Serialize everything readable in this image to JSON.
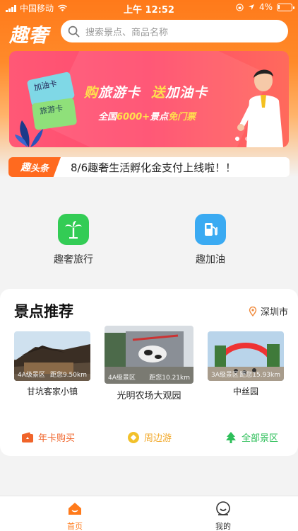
{
  "status_bar": {
    "carrier": "中国移动",
    "time": "上午 12:52",
    "battery": "4%"
  },
  "header": {
    "logo": "趣奢",
    "search_placeholder": "搜索景点、商品名称"
  },
  "banner": {
    "card_top": "加油卡",
    "card_bottom": "旅游卡",
    "title_a_hl": "购",
    "title_a": "旅游卡",
    "title_b_hl": "送",
    "title_b": "加油卡",
    "sub_a": "全国",
    "sub_num": "6000+",
    "sub_b": "景点",
    "sub_hl": "免门票"
  },
  "headline": {
    "badge_a": "趣",
    "badge_b": "头条",
    "text": "8/6趣奢生活孵化金支付上线啦！！"
  },
  "services": [
    {
      "label": "趣奢旅行",
      "icon": "palm-tree-icon",
      "color": "#33cc55"
    },
    {
      "label": "趣加油",
      "icon": "fuel-pump-icon",
      "color": "#3aaaf2"
    }
  ],
  "recommend": {
    "title": "景点推荐",
    "location": "深圳市",
    "spots": [
      {
        "name": "甘坑客家小镇",
        "tag": "4A级景区",
        "distance": "距您9.50km"
      },
      {
        "name": "光明农场大观园",
        "tag": "4A级景区",
        "distance": "距您10.21km"
      },
      {
        "name": "中丝园",
        "tag": "3A级景区",
        "distance": "距您15.93km"
      }
    ],
    "links": [
      {
        "label": "年卡购买",
        "icon": "wallet-icon",
        "color": "#f0642a"
      },
      {
        "label": "周边游",
        "icon": "coin-icon",
        "color": "#f2c12b"
      },
      {
        "label": "全部景区",
        "icon": "tree-icon",
        "color": "#2ebf5a"
      }
    ]
  },
  "tabbar": {
    "home": "首页",
    "mine": "我的",
    "active_color": "#ff7a1a"
  }
}
